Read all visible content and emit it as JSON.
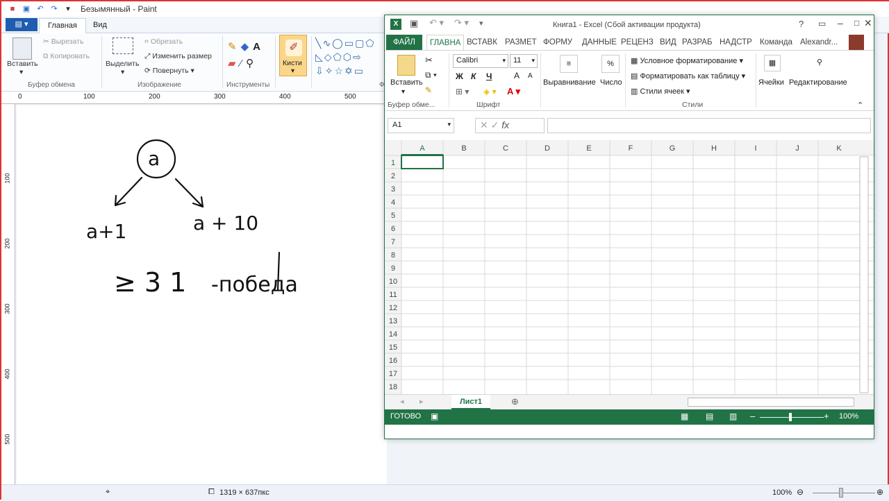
{
  "paint": {
    "title": "Безымянный - Paint",
    "file_tab": "▤ ▾",
    "tabs": [
      "Главная",
      "Вид"
    ],
    "clipboard": {
      "paste": "Вставить",
      "cut": "Вырезать",
      "copy": "Копировать",
      "label": "Буфер обмена"
    },
    "image": {
      "select": "Выделить",
      "crop": "Обрезать",
      "resize": "Изменить размер",
      "rotate": "Повернуть",
      "label": "Изображение"
    },
    "tools": {
      "label": "Инструменты"
    },
    "brushes": "Кисти",
    "shapes_label": "Ф",
    "ruler": [
      "0",
      "100",
      "200",
      "300",
      "400",
      "500"
    ],
    "vruler": [
      "100",
      "200",
      "300",
      "400",
      "500"
    ],
    "status": {
      "size": "1319 × 637пкс",
      "zoom": "100%"
    }
  },
  "excel": {
    "title": "Книга1 - Excel (Сбой активации продукта)",
    "file_tab": "ФАЙЛ",
    "tabs": [
      "ГЛАВНА",
      "ВСТАВК",
      "РАЗМЕТ",
      "ФОРМУ",
      "ДАННЫЕ",
      "РЕЦЕНЗ",
      "ВИД",
      "РАЗРАБ",
      "НАДСТР",
      "Команда"
    ],
    "user": "Alexandr...",
    "clipboard": {
      "paste": "Вставить",
      "label": "Буфер обме..."
    },
    "font": {
      "name": "Calibri",
      "size": "11",
      "bold": "Ж",
      "italic": "К",
      "underline": "Ч",
      "grow": "A",
      "shrink": "A",
      "label": "Шрифт"
    },
    "align": "Выравнивание",
    "number": "Число",
    "number_icon": "%",
    "styles": {
      "cond": "Условное форматирование",
      "table": "Форматировать как таблицу",
      "cell": "Стили ячеек",
      "label": "Стили"
    },
    "cells": "Ячейки",
    "editing": "Редактирование",
    "namebox": "A1",
    "fx": "fx",
    "columns": [
      "A",
      "B",
      "C",
      "D",
      "E",
      "F",
      "G",
      "H",
      "I",
      "J",
      "K"
    ],
    "rows": [
      "1",
      "2",
      "3",
      "4",
      "5",
      "6",
      "7",
      "8",
      "9",
      "10",
      "11",
      "12",
      "13",
      "14",
      "15",
      "16",
      "17",
      "18"
    ],
    "sheet": "Лист1",
    "status": "ГОТОВО",
    "zoom": "100%"
  },
  "drawing": {
    "t1": "a",
    "t2": "a+1",
    "t3": "a + 10",
    "t4": "≥ 3 1",
    "t5": "-победа"
  }
}
